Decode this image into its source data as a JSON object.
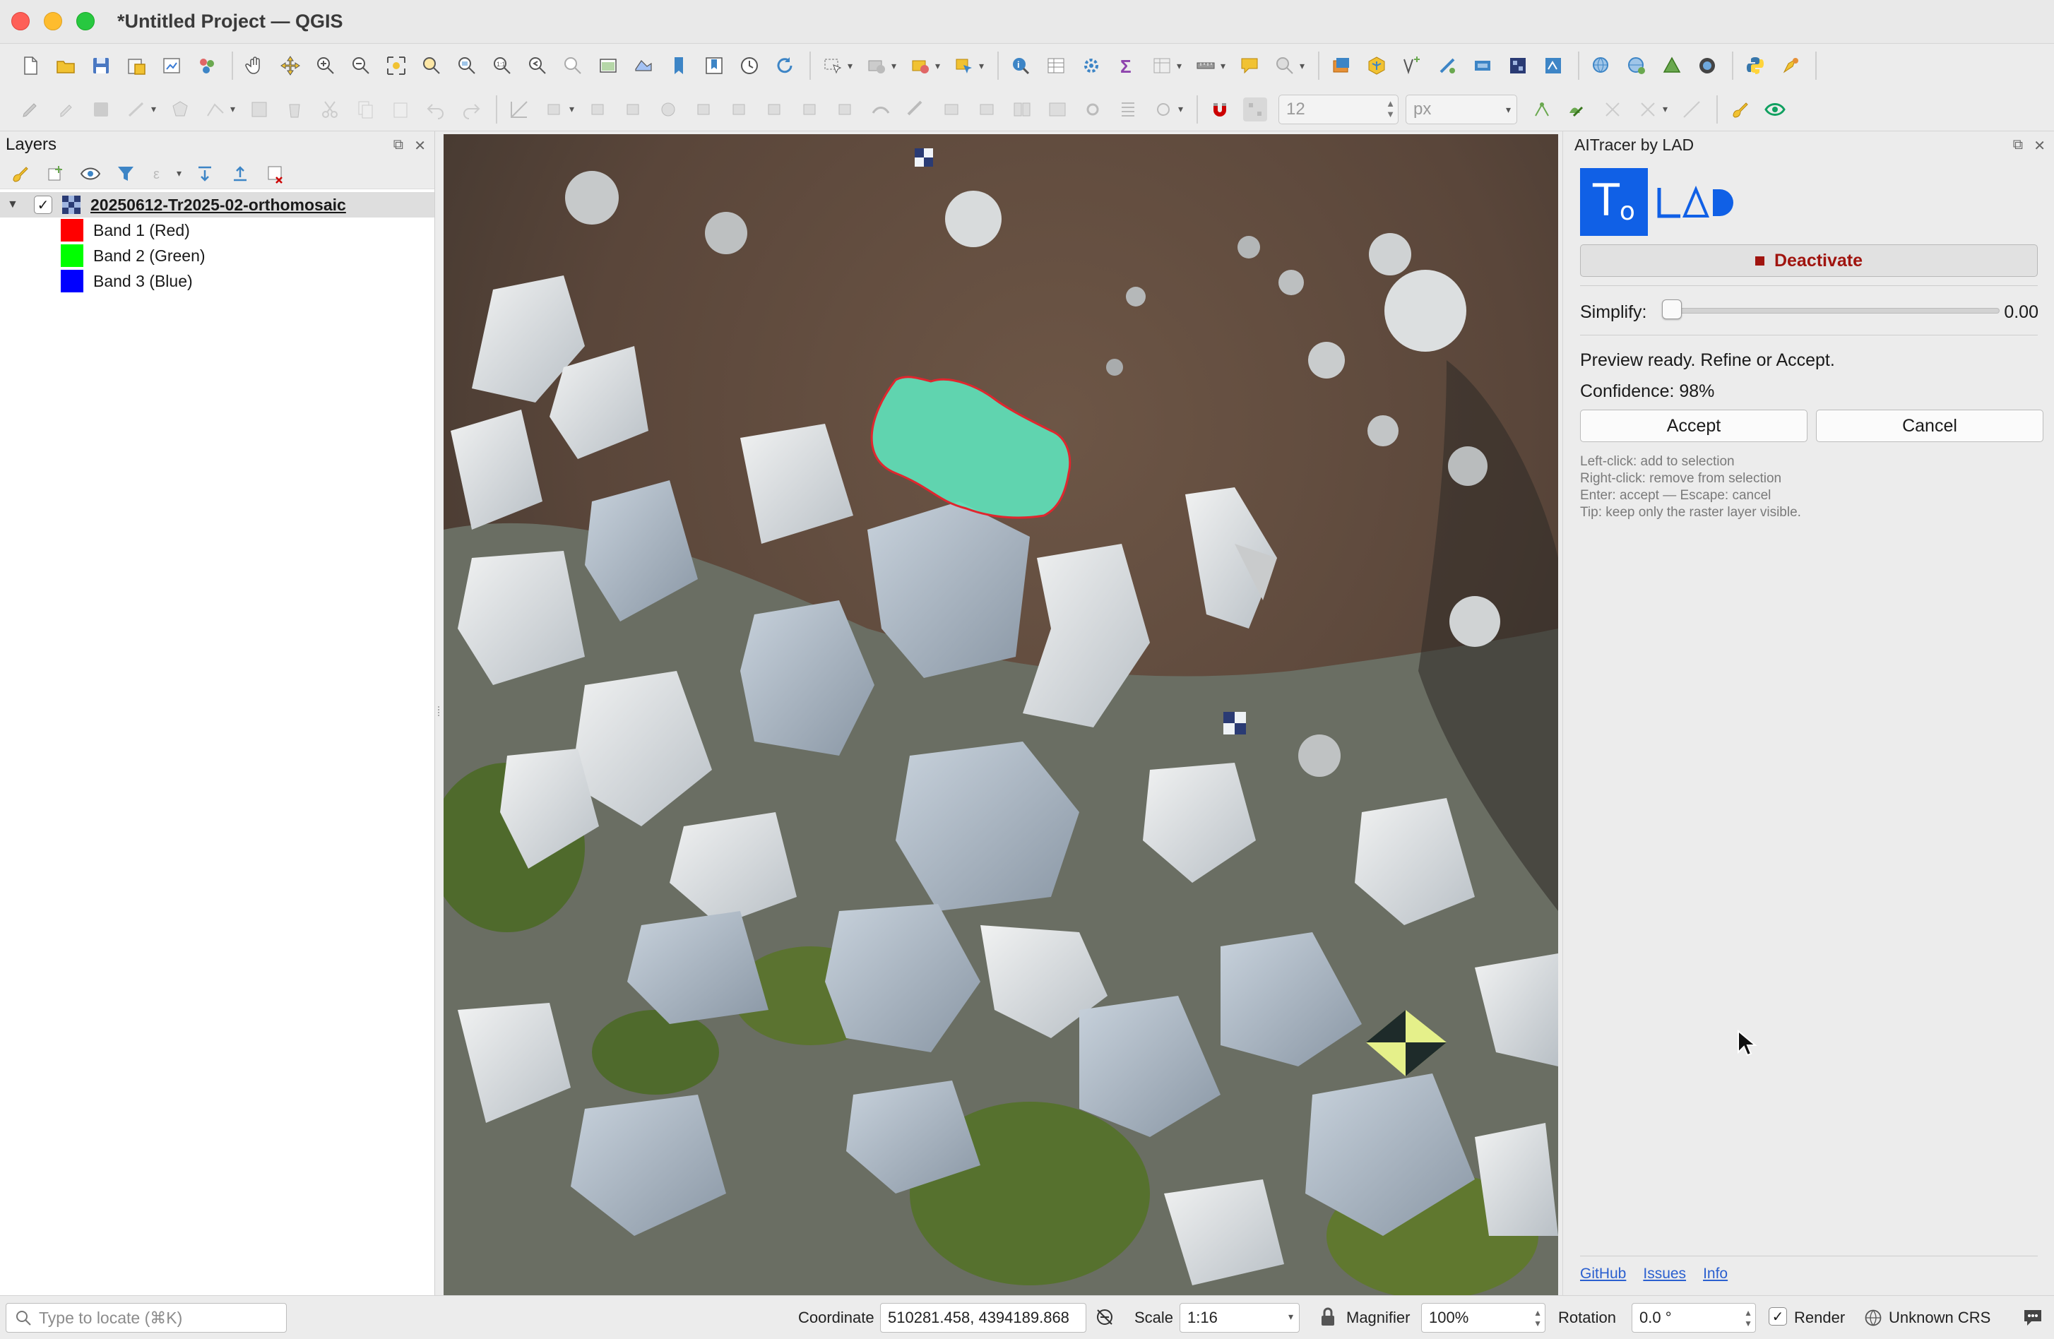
{
  "window": {
    "title": "*Untitled Project — QGIS"
  },
  "toolbar2": {
    "size_value": "12",
    "units_value": "px"
  },
  "layers_panel": {
    "title": "Layers",
    "layer": {
      "name": "20250612-Tr2025-02-orthomosaic",
      "checked": "✓",
      "bands": [
        {
          "label": "Band 1 (Red)",
          "color": "#ff0000"
        },
        {
          "label": "Band 2 (Green)",
          "color": "#00ff00"
        },
        {
          "label": "Band 3 (Blue)",
          "color": "#0000ff"
        }
      ]
    }
  },
  "plugin": {
    "title": "AITracer by LAD",
    "logo_letters": "T",
    "logo_sub": "O",
    "logo_brand": "LAD",
    "deactivate_label": "Deactivate",
    "simplify_label": "Simplify:",
    "simplify_value": "0.00",
    "simplify_level": 0.0,
    "status": "Preview ready. Refine or Accept.",
    "confidence": "Confidence: 98%",
    "accept_label": "Accept",
    "cancel_label": "Cancel",
    "hints": [
      "Left-click: add to selection",
      "Right-click: remove from selection",
      "Enter: accept — Escape: cancel",
      "Tip: keep only the raster layer visible."
    ],
    "links": [
      "GitHub",
      "Issues",
      "Info"
    ]
  },
  "statusbar": {
    "locate_placeholder": "Type to locate (⌘K)",
    "coordinate_label": "Coordinate",
    "coordinate_value": "510281.458, 4394189.868",
    "scale_label": "Scale",
    "scale_value": "1:16",
    "magnifier_label": "Magnifier",
    "magnifier_value": "100%",
    "rotation_label": "Rotation",
    "rotation_value": "0.0 °",
    "render_label": "Render",
    "render_checked": "✓",
    "crs_label": "Unknown CRS"
  },
  "colors": {
    "accent_blue": "#1060e6",
    "deactivate_red": "#a0140f",
    "selection_fill": "#5fe0b8",
    "selection_outline": "#e0262e"
  }
}
